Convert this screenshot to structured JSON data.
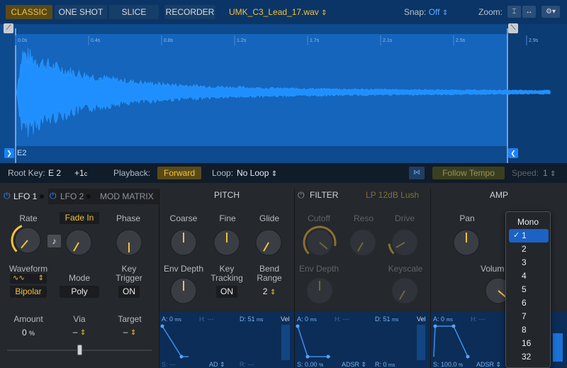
{
  "top_bar": {
    "modes": [
      "CLASSIC",
      "ONE SHOT",
      "SLICE"
    ],
    "active_mode": "CLASSIC",
    "recorder": "RECORDER",
    "file_name": "UMK_C3_Lead_17.wav",
    "file_chevron": "⇕",
    "snap_label": "Snap:",
    "snap_value": "Off",
    "snap_chevron": "⇕",
    "zoom_label": "Zoom:"
  },
  "waveform": {
    "time_ticks": [
      "0.0s",
      "0.4s",
      "0.8s",
      "1.2s",
      "1.7s",
      "2.1s",
      "2.5s",
      "2.9s"
    ],
    "note": "E2",
    "colors": {
      "background": "#0e4a8e",
      "wave": "#1f8fff",
      "loop_region": "#1565bd"
    }
  },
  "info_bar": {
    "root_key_label": "Root Key:",
    "root_key_value": "E 2",
    "tune_value": "+1",
    "tune_unit": "c",
    "playback_label": "Playback:",
    "playback_value": "Forward",
    "loop_label": "Loop:",
    "loop_value": "No Loop",
    "loop_chevron": "⇕",
    "follow_tempo": "Follow Tempo",
    "speed_label": "Speed:",
    "speed_value": "1",
    "speed_chevron": "⇕"
  },
  "lfo": {
    "tab1": "LFO 1",
    "tab2": "LFO 2",
    "tab3": "MOD MATRIX",
    "rate_label": "Rate",
    "fade_in": "Fade In",
    "phase_label": "Phase",
    "waveform_label": "Waveform",
    "waveform_value": "Bipolar",
    "mode_label": "Mode",
    "mode_value": "Poly",
    "key_trigger_label_1": "Key",
    "key_trigger_label_2": "Trigger",
    "key_trigger_value": "ON",
    "amount_label": "Amount",
    "amount_value": "0",
    "amount_unit": "%",
    "via_label": "Via",
    "via_value": "–",
    "target_label": "Target",
    "target_value": "–"
  },
  "pitch": {
    "title": "PITCH",
    "coarse": "Coarse",
    "fine": "Fine",
    "glide": "Glide",
    "env_depth": "Env Depth",
    "key_tracking_1": "Key",
    "key_tracking_2": "Tracking",
    "key_tracking_value": "ON",
    "bend_range_1": "Bend",
    "bend_range_2": "Range",
    "bend_range_value": "2",
    "env": {
      "a": "A: 0",
      "a_unit": "ms",
      "h": "H: ---",
      "d": "D: 51",
      "d_unit": "ms",
      "s": "S: ---",
      "type": "AD",
      "r": "R: ---",
      "vel": "Vel"
    }
  },
  "filter": {
    "title": "FILTER",
    "type": "LP 12dB Lush",
    "cutoff": "Cutoff",
    "reso": "Reso",
    "drive": "Drive",
    "env_depth": "Env Depth",
    "keyscale": "Keyscale",
    "env": {
      "a": "A: 0",
      "a_unit": "ms",
      "h": "H: ---",
      "d": "D: 51",
      "d_unit": "ms",
      "s": "S: 0.00",
      "s_unit": "%",
      "type": "ADSR",
      "r": "R: 0",
      "r_unit": "ms",
      "vel": "Vel"
    }
  },
  "amp": {
    "title": "AMP",
    "pan": "Pan",
    "volume": "Volum",
    "env": {
      "a": "A: 0",
      "a_unit": "ms",
      "h": "H: ---",
      "s": "S: 100.0",
      "s_unit": "%",
      "type": "ADSR"
    }
  },
  "voice_menu": {
    "header": "Mono",
    "items": [
      "1",
      "2",
      "3",
      "4",
      "5",
      "6",
      "7",
      "8",
      "16",
      "32"
    ],
    "selected": "1",
    "check": "✓"
  }
}
